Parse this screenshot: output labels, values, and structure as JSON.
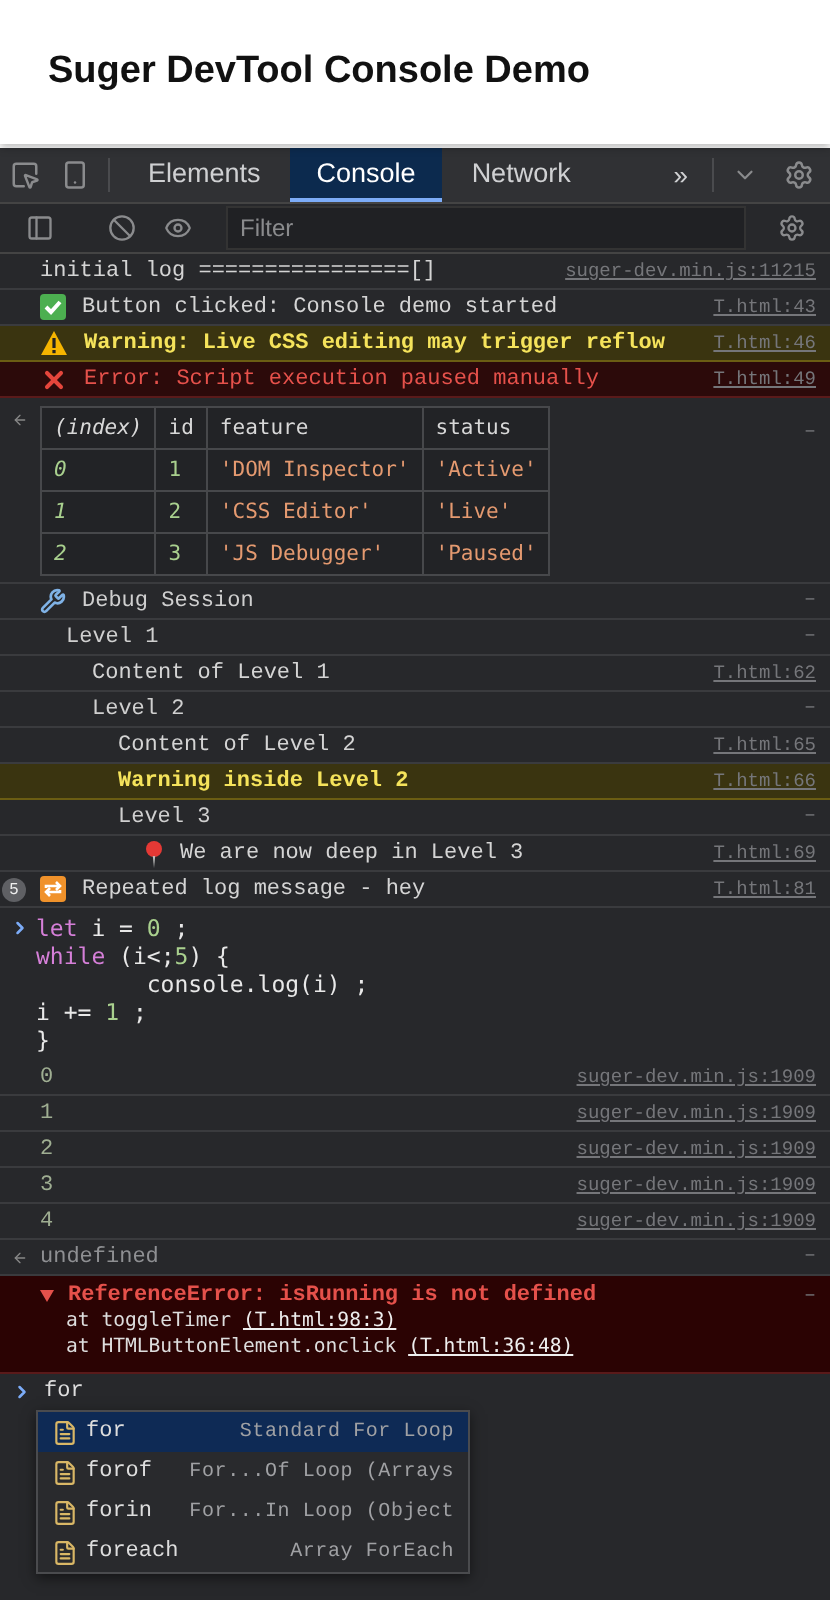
{
  "page_title": "Suger DevTool Console Demo",
  "devtools": {
    "tabs": [
      {
        "label": "Elements",
        "selected": false
      },
      {
        "label": "Console",
        "selected": true
      },
      {
        "label": "Network",
        "selected": false
      }
    ],
    "more_tabs": "»",
    "filter": {
      "placeholder": "Filter"
    },
    "messages": [
      {
        "kind": "log",
        "text": "initial log ================[]",
        "source": "suger-dev.min.js:11215"
      },
      {
        "kind": "success",
        "text": "Button clicked: Console demo started",
        "source": "T.html:43"
      },
      {
        "kind": "warning",
        "text": "Warning: Live CSS editing may trigger reflow",
        "source": "T.html:46"
      },
      {
        "kind": "error",
        "text": "Error: Script execution paused manually",
        "source": "T.html:49"
      },
      {
        "kind": "table",
        "marker": "–",
        "columns": [
          "(index)",
          "id",
          "feature",
          "status"
        ],
        "rows": [
          {
            "index": "0",
            "id": "1",
            "feature": "'DOM Inspector'",
            "status": "'Active'"
          },
          {
            "index": "1",
            "id": "2",
            "feature": "'CSS Editor'",
            "status": "'Live'"
          },
          {
            "index": "2",
            "id": "3",
            "feature": "'JS Debugger'",
            "status": "'Paused'"
          }
        ]
      },
      {
        "kind": "group",
        "label": "Debug Session",
        "marker": "–",
        "children": [
          {
            "kind": "group",
            "label": "Level 1",
            "marker": "–",
            "children": [
              {
                "kind": "log",
                "text": "Content of Level 1",
                "source": "T.html:62"
              },
              {
                "kind": "group",
                "label": "Level 2",
                "marker": "–",
                "children": [
                  {
                    "kind": "log",
                    "text": "Content of Level 2",
                    "source": "T.html:65"
                  },
                  {
                    "kind": "warning",
                    "text": "Warning inside Level 2",
                    "source": "T.html:66"
                  },
                  {
                    "kind": "group",
                    "label": "Level 3",
                    "marker": "–",
                    "children": [
                      {
                        "kind": "pinned",
                        "text": "We are now deep in Level 3",
                        "source": "T.html:69"
                      }
                    ]
                  }
                ]
              }
            ]
          }
        ]
      },
      {
        "kind": "repeated",
        "count": "5",
        "text": "Repeated log message - hey",
        "source": "T.html:81"
      },
      {
        "kind": "input",
        "lines": [
          [
            {
              "keyword": "let"
            },
            {
              "text": " i = "
            },
            {
              "number": "0"
            },
            {
              "text": " ;"
            }
          ],
          [
            {
              "keyword": "while"
            },
            {
              "text": " (i<;"
            },
            {
              "number": "5"
            },
            {
              "text": ") {"
            }
          ],
          [
            {
              "text": "        console.log(i) ;"
            }
          ],
          [
            {
              "text": "i += "
            },
            {
              "number": "1"
            },
            {
              "text": " ;"
            }
          ],
          [
            {
              "text": "}"
            }
          ]
        ]
      },
      {
        "kind": "output",
        "text": "0",
        "source": "suger-dev.min.js:1909"
      },
      {
        "kind": "output",
        "text": "1",
        "source": "suger-dev.min.js:1909"
      },
      {
        "kind": "output",
        "text": "2",
        "source": "suger-dev.min.js:1909"
      },
      {
        "kind": "output",
        "text": "3",
        "source": "suger-dev.min.js:1909"
      },
      {
        "kind": "output",
        "text": "4",
        "source": "suger-dev.min.js:1909"
      },
      {
        "kind": "result",
        "text": "undefined",
        "marker": "–"
      },
      {
        "kind": "exception",
        "expanded": true,
        "text": "ReferenceError: isRunning is not defined",
        "marker": "–",
        "stack": [
          {
            "text": "at toggleTimer",
            "link": "(T.html:98:3)"
          },
          {
            "text": "at HTMLButtonElement.onclick",
            "link": "(T.html:36:48)"
          }
        ]
      },
      {
        "kind": "prompt",
        "value": "for",
        "suggestions": [
          {
            "label": "for",
            "description": "Standard For Loop",
            "selected": true
          },
          {
            "label": "forof",
            "description": "For...Of Loop (Arrays",
            "selected": false
          },
          {
            "label": "forin",
            "description": "For...In Loop (Object",
            "selected": false
          },
          {
            "label": "foreach",
            "description": "Array ForEach",
            "selected": false
          }
        ]
      }
    ]
  }
}
